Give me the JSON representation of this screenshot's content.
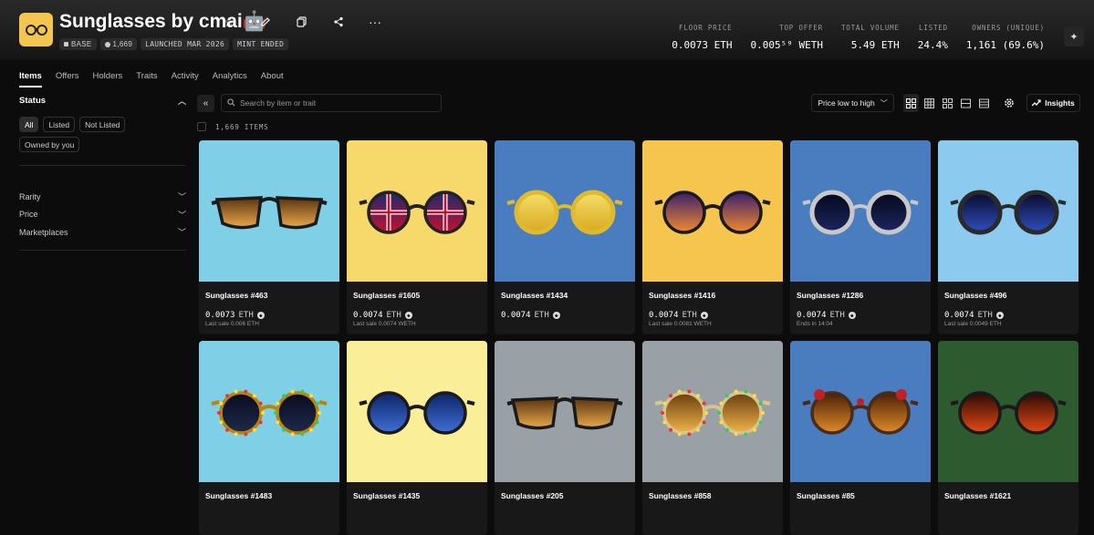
{
  "collection": {
    "title": "Sunglasses by cmai🤖",
    "chips": [
      {
        "icon": "base-chain-icon",
        "label": "BASE"
      },
      {
        "icon": "items-stack-icon",
        "label": "1,669"
      },
      {
        "icon": "",
        "label": "LAUNCHED MAR 2026"
      },
      {
        "icon": "",
        "label": "MINT ENDED"
      }
    ],
    "logo_color": "#f4c64e"
  },
  "stats": [
    {
      "label": "FLOOR PRICE",
      "value": "0.0073 ETH"
    },
    {
      "label": "TOP OFFER",
      "value": "0.005⁵⁹ WETH"
    },
    {
      "label": "TOTAL VOLUME",
      "value": "5.49 ETH"
    },
    {
      "label": "LISTED",
      "value": "24.4%"
    },
    {
      "label": "OWNERS (UNIQUE)",
      "value": "1,161 (69.6%)"
    }
  ],
  "tabs": [
    "Items",
    "Offers",
    "Holders",
    "Traits",
    "Activity",
    "Analytics",
    "About"
  ],
  "sidebar": {
    "status_title": "Status",
    "status_filters": [
      "All",
      "Listed",
      "Not Listed",
      "Owned by you"
    ],
    "sections": [
      "Rarity",
      "Price",
      "Marketplaces"
    ]
  },
  "toolbar": {
    "search_placeholder": "Search by item or trait",
    "sort_label": "Price low to high",
    "insights_label": "Insights",
    "count_text": "1,669 ITEMS"
  },
  "items": [
    {
      "name": "Sunglasses #463",
      "price": "0.0073",
      "unit": "ETH",
      "sub": "Last sale 0.006 ETH",
      "bg": "#7fd0e6",
      "style": "wayfarer-brown"
    },
    {
      "name": "Sunglasses #1605",
      "price": "0.0074",
      "unit": "ETH",
      "sub": "Last sale 0.0074 WETH",
      "bg": "#f6d96a",
      "style": "union-jack"
    },
    {
      "name": "Sunglasses #1434",
      "price": "0.0074",
      "unit": "ETH",
      "sub": "",
      "bg": "#4a7cc0",
      "style": "melting-gold"
    },
    {
      "name": "Sunglasses #1416",
      "price": "0.0074",
      "unit": "ETH",
      "sub": "Last sale 0.0081 WETH",
      "bg": "#f5c54e",
      "style": "sunset-palms"
    },
    {
      "name": "Sunglasses #1286",
      "price": "0.0074",
      "unit": "ETH",
      "sub": "Ends in 14:04",
      "bg": "#4a7cc0",
      "style": "space-helmet"
    },
    {
      "name": "Sunglasses #496",
      "price": "0.0074",
      "unit": "ETH",
      "sub": "Last sale 0.0049 ETH",
      "bg": "#8dcaf0",
      "style": "camera-lens"
    },
    {
      "name": "Sunglasses #1483",
      "price": "",
      "unit": "",
      "sub": "",
      "bg": "#7fd0e6",
      "style": "jeweled-round"
    },
    {
      "name": "Sunglasses #1435",
      "price": "",
      "unit": "",
      "sub": "",
      "bg": "#fbee99",
      "style": "starry-night"
    },
    {
      "name": "Sunglasses #205",
      "price": "",
      "unit": "",
      "sub": "",
      "bg": "#9aa1a6",
      "style": "wayfarer-brown"
    },
    {
      "name": "Sunglasses #858",
      "price": "",
      "unit": "",
      "sub": "",
      "bg": "#9aa1a6",
      "style": "pearl-round"
    },
    {
      "name": "Sunglasses #85",
      "price": "",
      "unit": "",
      "sub": "",
      "bg": "#4a7cc0",
      "style": "rose-round"
    },
    {
      "name": "Sunglasses #1621",
      "price": "",
      "unit": "",
      "sub": "",
      "bg": "#2d5a2e",
      "style": "volcano"
    }
  ]
}
